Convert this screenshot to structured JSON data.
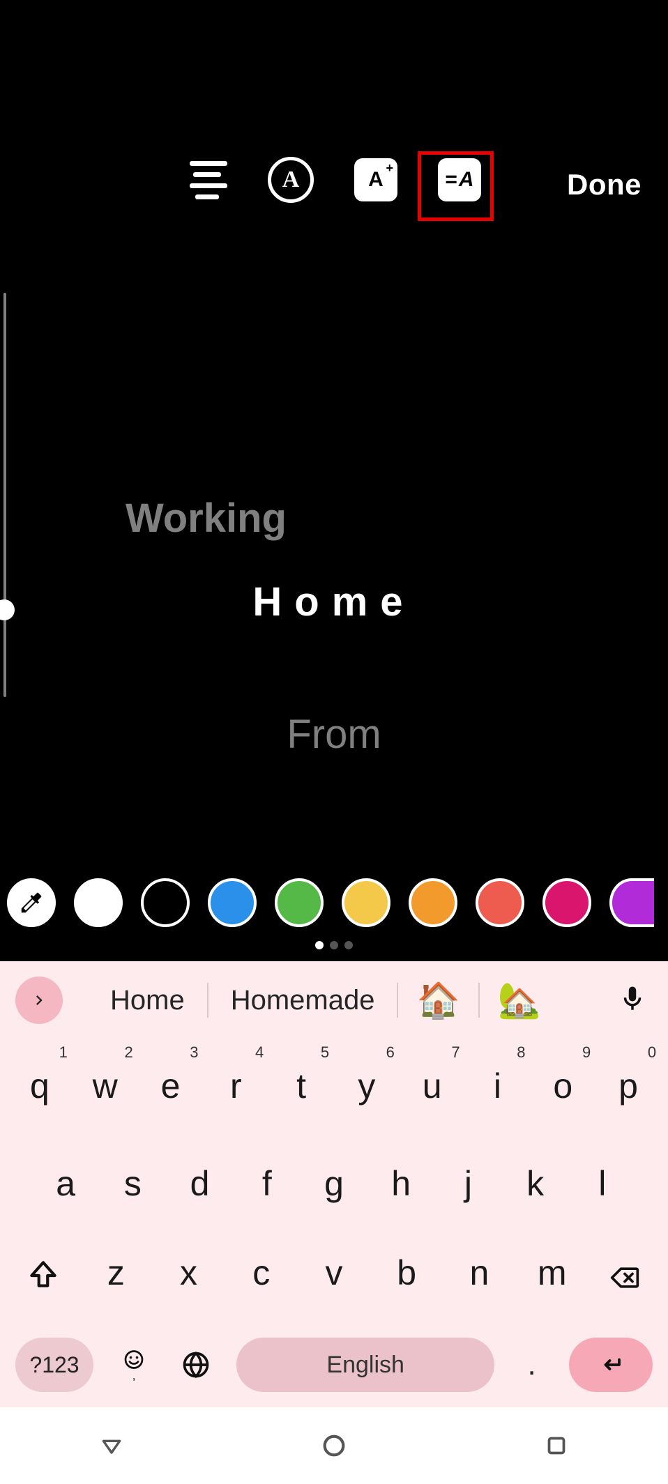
{
  "toolbar": {
    "font_circle_label": "A",
    "font_size_label": "A",
    "font_size_sup": "+",
    "animation_label": "A",
    "done_label": "Done"
  },
  "canvas_text": {
    "line1": "Working",
    "line2": "Home",
    "line3": "From"
  },
  "color_swatches": [
    {
      "id": "eyedropper",
      "hex": "#ffffff"
    },
    {
      "id": "white",
      "hex": "#ffffff"
    },
    {
      "id": "black",
      "hex": "#000000"
    },
    {
      "id": "blue",
      "hex": "#2b90e9"
    },
    {
      "id": "green",
      "hex": "#55b948"
    },
    {
      "id": "yellow",
      "hex": "#f4c94a"
    },
    {
      "id": "orange",
      "hex": "#f39a2d"
    },
    {
      "id": "coral",
      "hex": "#ee5c50"
    },
    {
      "id": "magenta",
      "hex": "#d9156e"
    },
    {
      "id": "purple",
      "hex": "#b22bd8"
    }
  ],
  "pager": {
    "total": 3,
    "active": 0
  },
  "suggestions": {
    "items": [
      "Home",
      "Homemade"
    ],
    "emojis": [
      "🏠",
      "🏡"
    ]
  },
  "keyboard": {
    "row1": [
      {
        "k": "q",
        "n": "1"
      },
      {
        "k": "w",
        "n": "2"
      },
      {
        "k": "e",
        "n": "3"
      },
      {
        "k": "r",
        "n": "4"
      },
      {
        "k": "t",
        "n": "5"
      },
      {
        "k": "y",
        "n": "6"
      },
      {
        "k": "u",
        "n": "7"
      },
      {
        "k": "i",
        "n": "8"
      },
      {
        "k": "o",
        "n": "9"
      },
      {
        "k": "p",
        "n": "0"
      }
    ],
    "row2": [
      "a",
      "s",
      "d",
      "f",
      "g",
      "h",
      "j",
      "k",
      "l"
    ],
    "row3": [
      "z",
      "x",
      "c",
      "v",
      "b",
      "n",
      "m"
    ],
    "symbols_label": "?123",
    "space_label": "English",
    "dot_label": "."
  }
}
